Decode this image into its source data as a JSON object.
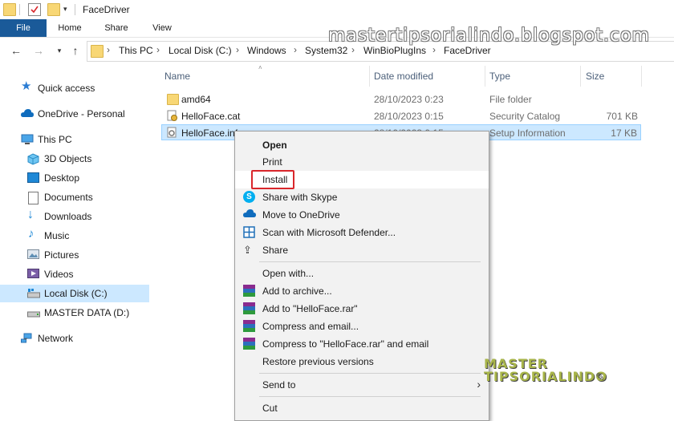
{
  "window": {
    "title": "FaceDriver"
  },
  "ribbon": {
    "tabs": [
      "File",
      "Home",
      "Share",
      "View"
    ]
  },
  "address": {
    "crumbs": [
      "This PC",
      "Local Disk (C:)",
      "Windows",
      "System32",
      "WinBioPlugIns",
      "FaceDriver"
    ]
  },
  "nav": {
    "items": [
      {
        "label": "Quick access",
        "icon": "star-icon"
      },
      {
        "label": "OneDrive - Personal",
        "icon": "cloud-icon"
      },
      {
        "label": "This PC",
        "icon": "computer-icon"
      },
      {
        "label": "3D Objects",
        "icon": "cube-icon"
      },
      {
        "label": "Desktop",
        "icon": "desktop-icon"
      },
      {
        "label": "Documents",
        "icon": "document-icon"
      },
      {
        "label": "Downloads",
        "icon": "download-icon"
      },
      {
        "label": "Music",
        "icon": "music-icon"
      },
      {
        "label": "Pictures",
        "icon": "picture-icon"
      },
      {
        "label": "Videos",
        "icon": "video-icon"
      },
      {
        "label": "Local Disk (C:)",
        "icon": "drive-icon"
      },
      {
        "label": "MASTER DATA (D:)",
        "icon": "drive-icon"
      },
      {
        "label": "Network",
        "icon": "network-icon"
      }
    ]
  },
  "columns": {
    "name": "Name",
    "date": "Date modified",
    "type": "Type",
    "size": "Size"
  },
  "files": [
    {
      "name": "amd64",
      "date": "28/10/2023 0:23",
      "type": "File folder",
      "size": ""
    },
    {
      "name": "HelloFace.cat",
      "date": "28/10/2023 0:15",
      "type": "Security Catalog",
      "size": "701 KB"
    },
    {
      "name": "HelloFace.inf",
      "date": "28/10/2023 0:15",
      "type": "Setup Information",
      "size": "17 KB"
    }
  ],
  "context_menu": {
    "items": [
      {
        "label": "Open"
      },
      {
        "label": "Print"
      },
      {
        "label": "Install"
      },
      {
        "label": "Share with Skype"
      },
      {
        "label": "Move to OneDrive"
      },
      {
        "label": "Scan with Microsoft Defender..."
      },
      {
        "label": "Share"
      },
      {
        "label": "Open with..."
      },
      {
        "label": "Add to archive..."
      },
      {
        "label": "Add to \"HelloFace.rar\""
      },
      {
        "label": "Compress and email..."
      },
      {
        "label": "Compress to \"HelloFace.rar\" and email"
      },
      {
        "label": "Restore previous versions"
      },
      {
        "label": "Send to"
      },
      {
        "label": "Cut"
      }
    ]
  },
  "watermark": {
    "text": "mastertipsorialindo.blogspot.com",
    "logo_line1": "MASTER",
    "logo_line2": "TIPSORIALINDO"
  },
  "colors": {
    "file_tab": "#1a5a99",
    "selection": "#cce8ff",
    "highlight_box": "#d9262b",
    "folder": "#f8d775"
  }
}
